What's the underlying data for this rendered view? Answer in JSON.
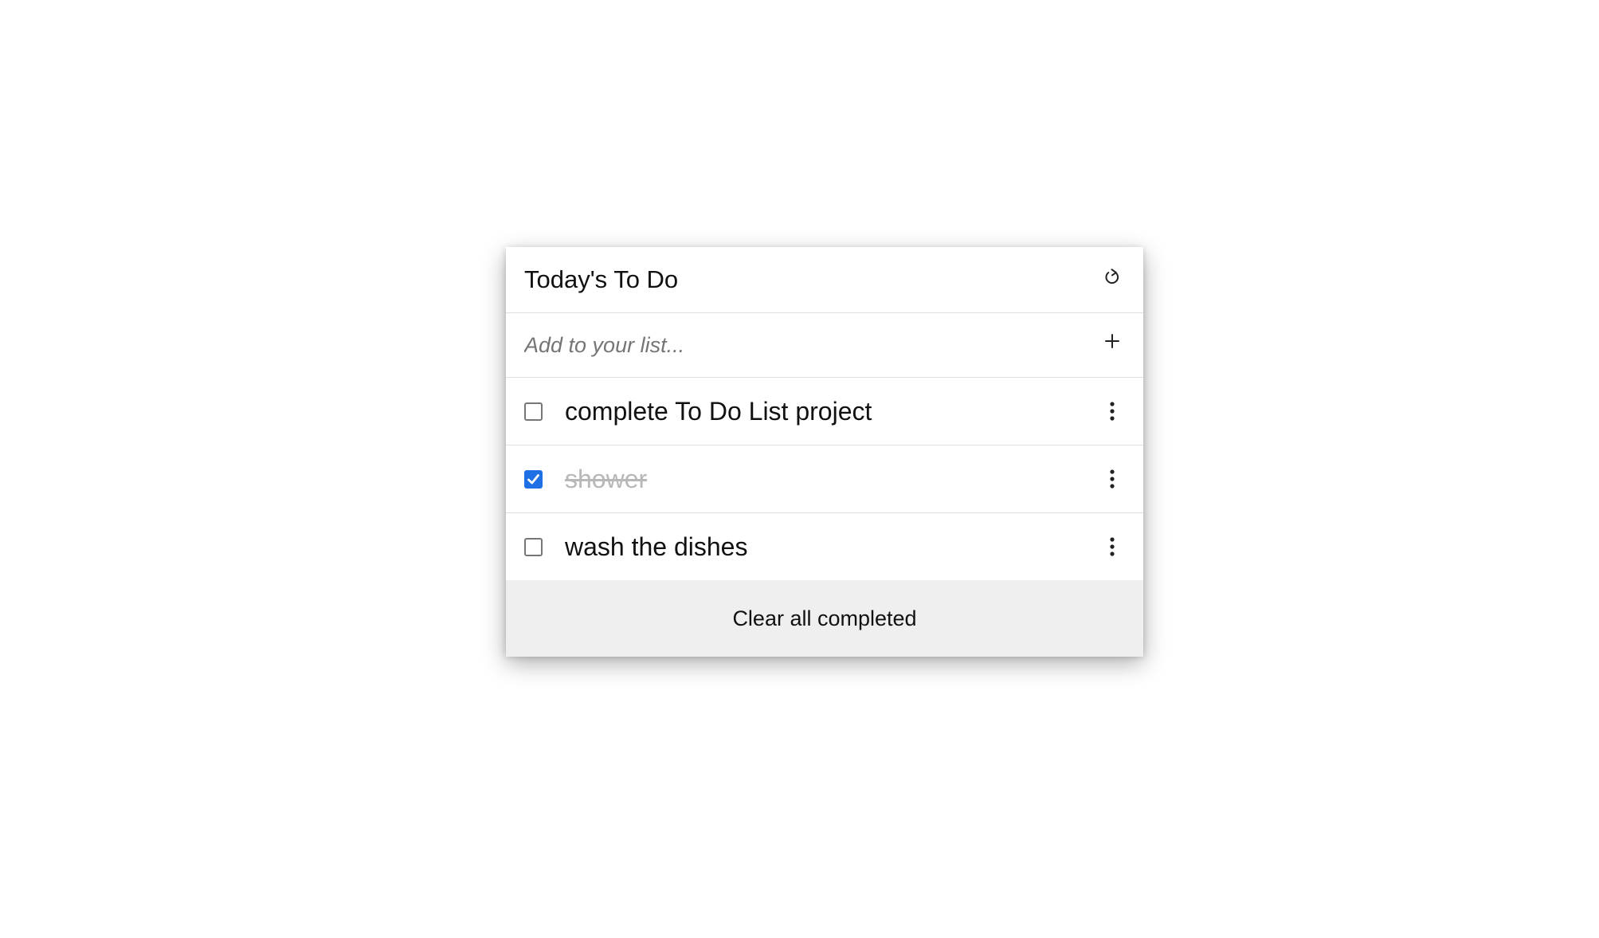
{
  "header": {
    "title": "Today's To Do",
    "refresh_icon": "refresh-icon"
  },
  "add": {
    "placeholder": "Add to your list...",
    "value": "",
    "add_icon": "plus-icon"
  },
  "tasks": [
    {
      "label": "complete To Do List project",
      "completed": false,
      "menu_icon": "more-vertical-icon"
    },
    {
      "label": "shower",
      "completed": true,
      "menu_icon": "more-vertical-icon"
    },
    {
      "label": "wash the dishes",
      "completed": false,
      "menu_icon": "more-vertical-icon"
    }
  ],
  "footer": {
    "clear_label": "Clear all completed"
  },
  "colors": {
    "checkbox_checked": "#1f6fe5",
    "completed_text": "#b8b8b8",
    "footer_bg": "#efefef"
  }
}
